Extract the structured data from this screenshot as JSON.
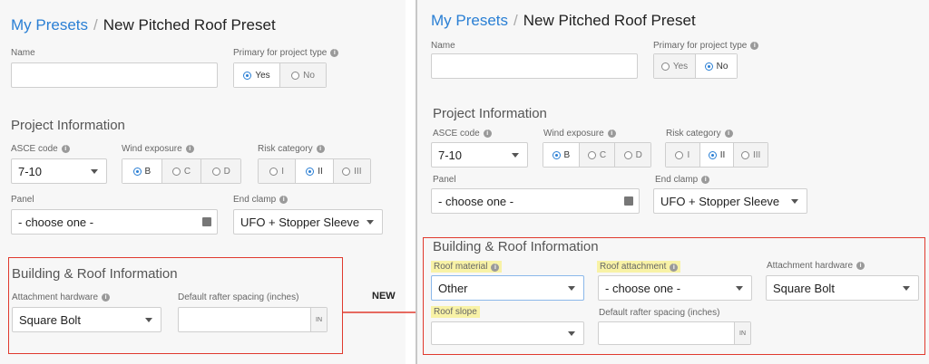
{
  "left": {
    "breadcrumb": {
      "parent": "My Presets",
      "separator": "/",
      "current": "New Pitched Roof Preset"
    },
    "name_label": "Name",
    "primary_label": "Primary for project type",
    "primary_options": [
      "Yes",
      "No"
    ],
    "project_section": "Project Information",
    "asce_label": "ASCE code",
    "asce_value": "7-10",
    "wind_label": "Wind exposure",
    "wind_options": [
      "B",
      "C",
      "D"
    ],
    "risk_label": "Risk category",
    "risk_options": [
      "I",
      "II",
      "III"
    ],
    "panel_label": "Panel",
    "panel_value": "- choose one -",
    "clamp_label": "End clamp",
    "clamp_value": "UFO + Stopper Sleeve",
    "building_section": "Building & Roof Information",
    "attachment_label": "Attachment hardware",
    "attachment_value": "Square Bolt",
    "rafter_label": "Default rafter spacing (inches)",
    "rafter_unit": "IN"
  },
  "annotation": {
    "label": "NEW",
    "arrow_color": "#e03a2e"
  },
  "right": {
    "breadcrumb": {
      "parent": "My Presets",
      "separator": "/",
      "current": "New Pitched Roof Preset"
    },
    "name_label": "Name",
    "primary_label": "Primary for project type",
    "primary_options": [
      "Yes",
      "No"
    ],
    "project_section": "Project Information",
    "asce_label": "ASCE code",
    "asce_value": "7-10",
    "wind_label": "Wind exposure",
    "wind_options": [
      "B",
      "C",
      "D"
    ],
    "risk_label": "Risk category",
    "risk_options": [
      "I",
      "II",
      "III"
    ],
    "panel_label": "Panel",
    "panel_value": "- choose one -",
    "clamp_label": "End clamp",
    "clamp_value": "UFO + Stopper Sleeve",
    "building_section": "Building & Roof Information",
    "roof_material_label": "Roof material",
    "roof_material_value": "Other",
    "roof_attachment_label": "Roof attachment",
    "roof_attachment_value": "- choose one -",
    "attachment_label": "Attachment hardware",
    "attachment_value": "Square Bolt",
    "roof_slope_label": "Roof slope",
    "roof_slope_value": "",
    "rafter_label": "Default rafter spacing (inches)",
    "rafter_unit": "IN"
  },
  "colors": {
    "accent": "#2a7fd4",
    "highlight": "#f8f2a6",
    "annotation_red": "#e03a2e"
  }
}
